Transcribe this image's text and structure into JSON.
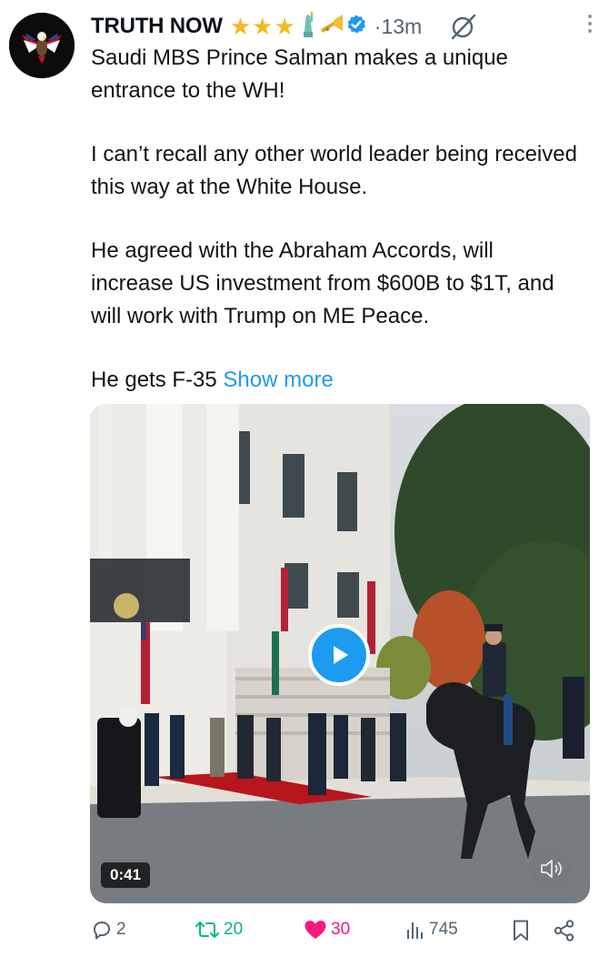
{
  "post": {
    "author_name": "TRUTH NOW",
    "timestamp": "13m",
    "separator": "·",
    "badges": [
      "star-icon",
      "star-icon",
      "star-icon",
      "statue-of-liberty-icon",
      "trumpet-icon",
      "verified-badge-icon"
    ],
    "paragraphs": [
      "Saudi MBS Prince Salman makes a unique entrance to the WH!",
      "I can’t recall any other world leader being received this way at the White House.",
      "He agreed with the Abraham Accords, will increase US investment from $600B to $1T, and will work with Trump on ME Peace."
    ],
    "last_line": "He gets F-35",
    "show_more": "Show more"
  },
  "video": {
    "duration": "0:41"
  },
  "actions": {
    "replies": "2",
    "reposts": "20",
    "likes": "30",
    "views": "745"
  },
  "colors": {
    "accent": "#1d9bf0",
    "repost": "#00ba7c",
    "like": "#f91880",
    "muted_text": "#536471",
    "star": "#f5b921"
  }
}
